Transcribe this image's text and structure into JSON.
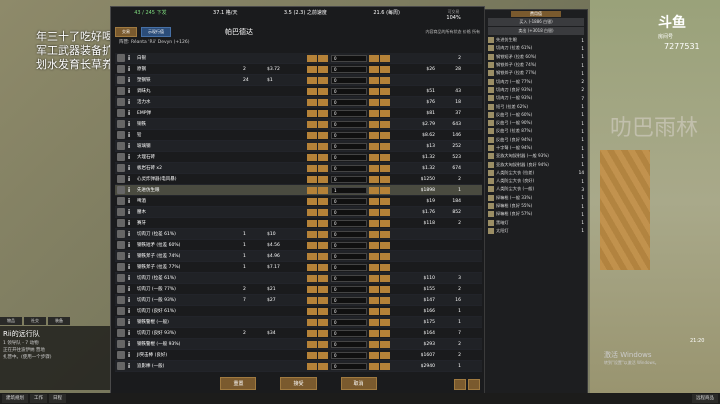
{
  "stream": {
    "line1": "年三十了吃好喝好",
    "line2": "军工武器装备扩展",
    "line3": "划水发育长草养生的日常",
    "logo": "斗鱼",
    "logo_sub": "房间号",
    "room_id": "7277531",
    "map_text": "叻巴雨林"
  },
  "header": {
    "stats": [
      {
        "label": "",
        "value": "43 / 245 下发",
        "green": true
      },
      {
        "label": "",
        "value": "37.1 格/天"
      },
      {
        "label": "",
        "value": "3.5 (2.3) 之前速度"
      },
      {
        "label": "",
        "value": "21.6 (每周)"
      },
      {
        "label": "可交易",
        "value": "104%"
      }
    ]
  },
  "subbar": {
    "btn_1": "交易",
    "btn_2": "示现行值",
    "center_name": "帕巴德达",
    "right_text": "内容商品的所有状态 价格 所有",
    "faction": "阵营: Réanta 'Rii' Devyn (+126)"
  },
  "rows": [
    {
      "name": "白银",
      "cnt": "",
      "price": "",
      "qty": "0",
      "tprice": "",
      "tcnt": "2"
    },
    {
      "name": "原钢",
      "cnt": "2",
      "price": "$3.72",
      "qty": "0",
      "tprice": "$26",
      "tcnt": "28"
    },
    {
      "name": "塑钢铁",
      "cnt": "24",
      "price": "$1",
      "qty": "0",
      "tprice": "",
      "tcnt": ""
    },
    {
      "name": "调味丸",
      "cnt": "",
      "price": "",
      "qty": "0",
      "tprice": "$51",
      "tcnt": "43"
    },
    {
      "name": "活力水",
      "cnt": "",
      "price": "",
      "qty": "0",
      "tprice": "$76",
      "tcnt": "18"
    },
    {
      "name": "EMP弹",
      "cnt": "",
      "price": "",
      "qty": "0",
      "tprice": "$81",
      "tcnt": "37"
    },
    {
      "name": "铜铁",
      "cnt": "",
      "price": "",
      "qty": "0",
      "tprice": "$2.79",
      "tcnt": "643"
    },
    {
      "name": "铅",
      "cnt": "",
      "price": "",
      "qty": "0",
      "tprice": "$8.62",
      "tcnt": "146"
    },
    {
      "name": "玻璃钢",
      "cnt": "",
      "price": "",
      "qty": "0",
      "tprice": "$13",
      "tcnt": "252"
    },
    {
      "name": "大理石砖",
      "cnt": "",
      "price": "",
      "qty": "0",
      "tprice": "$1.32",
      "tcnt": "523"
    },
    {
      "name": "板岩石砖 x2",
      "cnt": "",
      "price": "",
      "qty": "0",
      "tprice": "$1.32",
      "tcnt": "674"
    },
    {
      "name": "心灵炸弹器(电风暴)",
      "cnt": "",
      "price": "",
      "qty": "0",
      "tprice": "$1250",
      "tcnt": "2"
    },
    {
      "name": "先进仿生眼",
      "cnt": "",
      "price": "",
      "qty": "1",
      "tprice": "$1898",
      "tcnt": "1",
      "hl": true
    },
    {
      "name": "啤酒",
      "cnt": "",
      "price": "",
      "qty": "0",
      "tprice": "$19",
      "tcnt": "184"
    },
    {
      "name": "腰木",
      "cnt": "",
      "price": "",
      "qty": "0",
      "tprice": "$1.76",
      "tcnt": "852"
    },
    {
      "name": "赛牙",
      "cnt": "",
      "price": "",
      "qty": "0",
      "tprice": "$118",
      "tcnt": "2"
    },
    {
      "name": "切肉刀 (拉差 61%)",
      "cnt": "1",
      "price": "$10",
      "qty": "0",
      "tprice": "",
      "tcnt": ""
    },
    {
      "name": "钢铁短矛 (拉差 60%)",
      "cnt": "1",
      "price": "$4.56",
      "qty": "0",
      "tprice": "",
      "tcnt": ""
    },
    {
      "name": "钢铁斧子 (拉差 74%)",
      "cnt": "1",
      "price": "$4.96",
      "qty": "0",
      "tprice": "",
      "tcnt": ""
    },
    {
      "name": "钢铁斧子 (拉差 77%)",
      "cnt": "1",
      "price": "$7.17",
      "qty": "0",
      "tprice": "",
      "tcnt": ""
    },
    {
      "name": "切肉刀 (拉差 61%)",
      "cnt": "",
      "price": "",
      "qty": "0",
      "tprice": "$110",
      "tcnt": "3"
    },
    {
      "name": "切肉刀 (一般 77%)",
      "cnt": "2",
      "price": "$21",
      "qty": "0",
      "tprice": "$155",
      "tcnt": "2"
    },
    {
      "name": "切肉刀 (一般 93%)",
      "cnt": "7",
      "price": "$27",
      "qty": "0",
      "tprice": "$147",
      "tcnt": "16"
    },
    {
      "name": "切肉刀 (良好 61%)",
      "cnt": "",
      "price": "",
      "qty": "0",
      "tprice": "$166",
      "tcnt": "1"
    },
    {
      "name": "钢铁警棍 (一般)",
      "cnt": "",
      "price": "",
      "qty": "0",
      "tprice": "$175",
      "tcnt": "1"
    },
    {
      "name": "切肉刀 (良好 93%)",
      "cnt": "2",
      "price": "$34",
      "qty": "0",
      "tprice": "$164",
      "tcnt": "7"
    },
    {
      "name": "钢铁警棍 (一般 93%)",
      "cnt": "",
      "price": "",
      "qty": "0",
      "tprice": "$293",
      "tcnt": "2"
    },
    {
      "name": "JI突击棒 (良好)",
      "cnt": "",
      "price": "",
      "qty": "0",
      "tprice": "$1607",
      "tcnt": "2"
    },
    {
      "name": "追影棒 (一般)",
      "cnt": "",
      "price": "",
      "qty": "0",
      "tprice": "$2940",
      "tcnt": "1"
    }
  ],
  "footer": {
    "btn_1": "重置",
    "btn_2": "接受",
    "btn_3": "取消"
  },
  "side": {
    "tag": "费用值",
    "buy_section": "买入 (-1886 白银)",
    "sell_section": "卖出 (+3018 白银)",
    "items": [
      {
        "name": "先进仿生眼",
        "n": "1"
      },
      {
        "name": "切肉刀 (拉差 61%)",
        "n": "1"
      },
      {
        "name": "钢铁短矛 (拉差 60%)",
        "n": "1"
      },
      {
        "name": "钢铁斧子 (拉差 74%)",
        "n": "1"
      },
      {
        "name": "钢铁斧子 (拉差 77%)",
        "n": "1"
      },
      {
        "name": "切肉刀 (一般 77%)",
        "n": "2"
      },
      {
        "name": "切肉刀 (良好 93%)",
        "n": "2"
      },
      {
        "name": "切肉刀 (一般 93%)",
        "n": "7"
      },
      {
        "name": "短弓 (拉差 62%)",
        "n": "1"
      },
      {
        "name": "反曲弓 (一般 60%)",
        "n": "1"
      },
      {
        "name": "反曲弓 (一般 90%)",
        "n": "1"
      },
      {
        "name": "反曲弓 (拉差 87%)",
        "n": "1"
      },
      {
        "name": "反曲弓 (良好 94%)",
        "n": "1"
      },
      {
        "name": "十字弩 (一般 94%)",
        "n": "1"
      },
      {
        "name": "亚族大匈奴射器 (一般 93%)",
        "n": "1"
      },
      {
        "name": "亚族大匈奴射器 (良好 94%)",
        "n": "1"
      },
      {
        "name": "人类防尘大衣 (拉差)",
        "n": "14"
      },
      {
        "name": "人类防尘大衣 (良好)",
        "n": "1"
      },
      {
        "name": "人类防尘大衣 (一般)",
        "n": "3"
      },
      {
        "name": "探嘛枪 (一般 33%)",
        "n": "1"
      },
      {
        "name": "探嘛枪 (良好 55%)",
        "n": "1"
      },
      {
        "name": "探嘛枪 (良好 57%)",
        "n": "1"
      },
      {
        "name": "黑暗灯",
        "n": "1"
      },
      {
        "name": "太阳灯",
        "n": "1"
      }
    ]
  },
  "caravan": {
    "title": "Rii的远行队",
    "line1": "1 领导队 - 7 动物",
    "line2": "正在开往波伊纳 营地",
    "line3": "扎营中。(使用一个步骤)"
  },
  "left_tabs": [
    "物品",
    "社交",
    "装备"
  ],
  "bottom_bar": {
    "items": [
      "建筑规划",
      "工作",
      "日程"
    ],
    "right": "远程商品"
  },
  "time": "21:20",
  "windows_activate": "激活 Windows",
  "windows_activate_sub": "转到\"设置\"以激活 Windows。"
}
